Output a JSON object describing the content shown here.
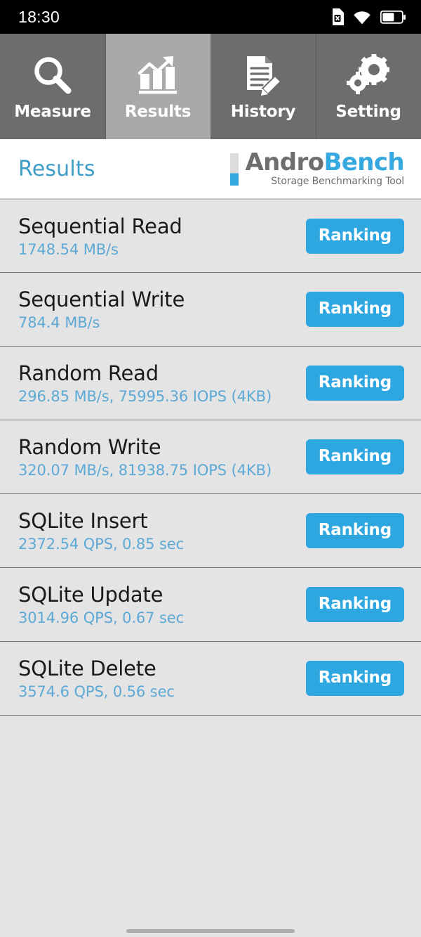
{
  "status_bar": {
    "time": "18:30",
    "icons": [
      "sim-card-off-icon",
      "wifi-icon",
      "battery-icon"
    ]
  },
  "tabs": [
    {
      "label": "Measure",
      "icon": "magnifier-icon",
      "active": false
    },
    {
      "label": "Results",
      "icon": "bar-chart-arrow-icon",
      "active": true
    },
    {
      "label": "History",
      "icon": "document-pencil-icon",
      "active": false
    },
    {
      "label": "Setting",
      "icon": "gears-icon",
      "active": false
    }
  ],
  "header": {
    "title": "Results",
    "logo_primary": "Andro",
    "logo_secondary": "Bench",
    "logo_tagline": "Storage Benchmarking Tool"
  },
  "results": [
    {
      "name": "Sequential Read",
      "value": "1748.54 MB/s",
      "button": "Ranking"
    },
    {
      "name": "Sequential Write",
      "value": "784.4 MB/s",
      "button": "Ranking"
    },
    {
      "name": "Random Read",
      "value": "296.85 MB/s, 75995.36 IOPS (4KB)",
      "button": "Ranking"
    },
    {
      "name": "Random Write",
      "value": "320.07 MB/s, 81938.75 IOPS (4KB)",
      "button": "Ranking"
    },
    {
      "name": "SQLite Insert",
      "value": "2372.54 QPS, 0.85 sec",
      "button": "Ranking"
    },
    {
      "name": "SQLite Update",
      "value": "3014.96 QPS, 0.67 sec",
      "button": "Ranking"
    },
    {
      "name": "SQLite Delete",
      "value": "3574.6 QPS, 0.56 sec",
      "button": "Ranking"
    }
  ],
  "colors": {
    "accent_blue": "#2ea7e0",
    "value_blue": "#5ca9d6",
    "title_blue": "#3e9ec7",
    "tab_inactive": "#6d6d6d",
    "tab_active": "#a9a9a9",
    "row_background": "#e4e4e4",
    "status_bar": "#000000"
  }
}
